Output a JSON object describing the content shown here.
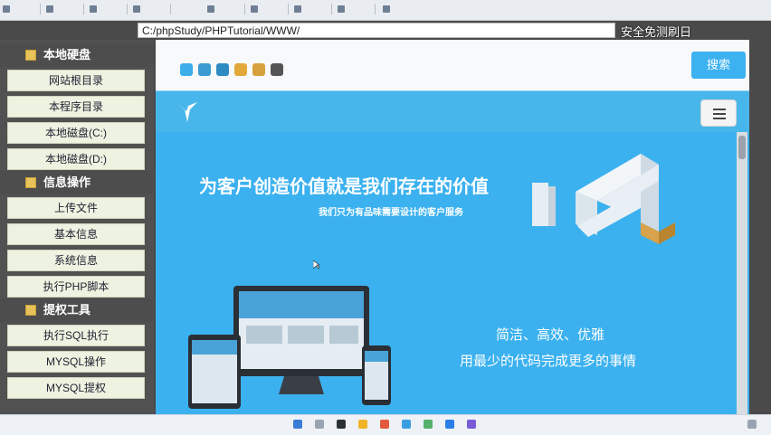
{
  "browser": {
    "tabs": [
      "",
      "",
      "",
      "",
      "",
      "",
      "",
      "",
      ""
    ],
    "address": "C:/phpStudy/PHPTutorial/WWW/",
    "overlay_text": "安全免测刷日"
  },
  "sidebar": {
    "sections": [
      {
        "title": "本地硬盘",
        "items": [
          "网站根目录",
          "本程序目录",
          "本地磁盘(C:)",
          "本地磁盘(D:)"
        ]
      },
      {
        "title": "信息操作",
        "items": [
          "上传文件",
          "基本信息",
          "系统信息",
          "执行PHP脚本"
        ]
      },
      {
        "title": "提权工具",
        "items": [
          "执行SQL执行",
          "MYSQL操作",
          "MYSQL提权"
        ]
      }
    ]
  },
  "page": {
    "search_label": "搜索",
    "swatch_colors": [
      "#3baeea",
      "#3b9bd1",
      "#2f8bc4",
      "#e2a83a",
      "#d6a13d",
      "#555555"
    ],
    "hero_title": "为客户创造价值就是我们存在的价值",
    "hero_subtitle": "我们只为有品味需要设计的客户服务",
    "slogan_line1": "简洁、高效、优雅",
    "slogan_line2": "用最少的代码完成更多的事情"
  }
}
